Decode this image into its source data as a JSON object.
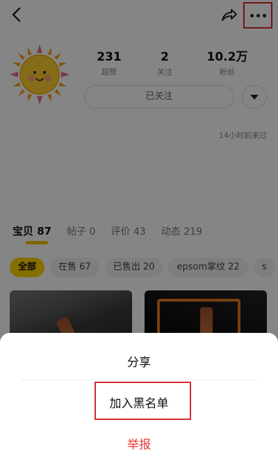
{
  "profile": {
    "stats": [
      {
        "value": "231",
        "label": "超赞"
      },
      {
        "value": "2",
        "label": "关注"
      },
      {
        "value": "10.2万",
        "label": "粉丝"
      }
    ],
    "follow_label": "已关注",
    "last_visit": "14小时前来过"
  },
  "tabs": [
    {
      "label": "宝贝",
      "count": "87",
      "active": true
    },
    {
      "label": "帖子",
      "count": "0"
    },
    {
      "label": "评价",
      "count": "43"
    },
    {
      "label": "动态",
      "count": "219"
    }
  ],
  "filters": [
    {
      "label": "全部",
      "active": true
    },
    {
      "label": "在售 67"
    },
    {
      "label": "已售出 20"
    },
    {
      "label": "epsom掌纹 22"
    },
    {
      "label": "s"
    }
  ],
  "sheet": {
    "share_label": "分享",
    "blacklist_label": "加入黑名单",
    "report_label": "举报"
  },
  "icons": {
    "back": "back-arrow-icon",
    "share": "share-icon",
    "more": "more-dots-icon",
    "dropdown": "caret-down-icon",
    "avatar": "sun-face-icon"
  },
  "colors": {
    "accent": "#ffd500",
    "highlight_box": "#d62828",
    "report": "#e53935",
    "overlay": "rgba(0,0,0,0.48)"
  }
}
